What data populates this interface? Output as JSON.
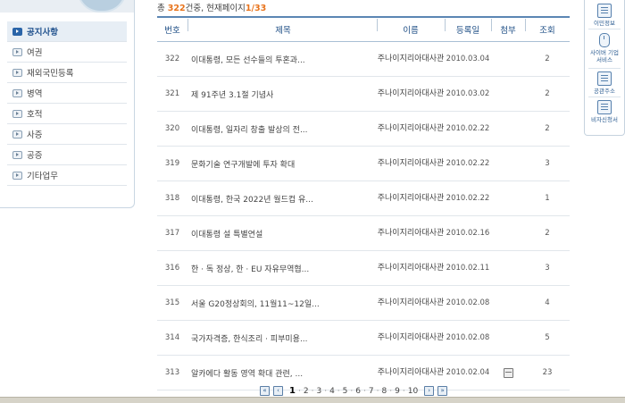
{
  "sidebar": {
    "items": [
      {
        "label": "공지사항",
        "active": true
      },
      {
        "label": "여권",
        "active": false
      },
      {
        "label": "재외국민등록",
        "active": false
      },
      {
        "label": "병역",
        "active": false
      },
      {
        "label": "호적",
        "active": false
      },
      {
        "label": "사증",
        "active": false
      },
      {
        "label": "공증",
        "active": false
      },
      {
        "label": "기타업무",
        "active": false
      }
    ]
  },
  "summary": {
    "prefix": "총 ",
    "total": "322",
    "middle": "건중, 현재페이지",
    "current": "1",
    "sep": "/",
    "pages": "33"
  },
  "table": {
    "headers": {
      "no": "번호",
      "title": "제목",
      "name": "이름",
      "date": "등록일",
      "attach": "첨부",
      "views": "조회"
    },
    "rows": [
      {
        "no": "322",
        "title": "이대통령, 모든 선수들의 투혼과...",
        "name": "주나이지리아대사관",
        "date": "2010.03.04",
        "attach": false,
        "views": "2"
      },
      {
        "no": "321",
        "title": "제 91주년 3.1절 기념사",
        "name": "주나이지리아대사관",
        "date": "2010.03.02",
        "attach": false,
        "views": "2"
      },
      {
        "no": "320",
        "title": "이대통령, 일자리 창출 발상의 전...",
        "name": "주나이지리아대사관",
        "date": "2010.02.22",
        "attach": false,
        "views": "2"
      },
      {
        "no": "319",
        "title": "문화기술 연구개발에 투자 확대",
        "name": "주나이지리아대사관",
        "date": "2010.02.22",
        "attach": false,
        "views": "3"
      },
      {
        "no": "318",
        "title": "이대통령, 한국 2022년 월드컵 유...",
        "name": "주나이지리아대사관",
        "date": "2010.02.22",
        "attach": false,
        "views": "1"
      },
      {
        "no": "317",
        "title": "이대통령 설 특별연설",
        "name": "주나이지리아대사관",
        "date": "2010.02.16",
        "attach": false,
        "views": "2"
      },
      {
        "no": "316",
        "title": "한 · 독 정상, 한 · EU 자유무역협...",
        "name": "주나이지리아대사관",
        "date": "2010.02.11",
        "attach": false,
        "views": "3"
      },
      {
        "no": "315",
        "title": "서울 G20정상회의, 11월11~12일...",
        "name": "주나이지리아대사관",
        "date": "2010.02.08",
        "attach": false,
        "views": "4"
      },
      {
        "no": "314",
        "title": "국가자격증, 한식조리 · 피부미용...",
        "name": "주나이지리아대사관",
        "date": "2010.02.08",
        "attach": false,
        "views": "5"
      },
      {
        "no": "313",
        "title": "알카에다 활동 영역 확대 관련, ...",
        "name": "주나이지리아대사관",
        "date": "2010.02.04",
        "attach": true,
        "views": "23"
      }
    ]
  },
  "pagination": {
    "current": "1",
    "pages": [
      "1",
      "2",
      "3",
      "4",
      "5",
      "6",
      "7",
      "8",
      "9",
      "10"
    ],
    "first_icon": "double-chevron-left-icon",
    "prev_icon": "chevron-left-icon",
    "next_icon": "chevron-right-icon",
    "last_icon": "double-chevron-right-icon"
  },
  "quick_panel": {
    "items": [
      {
        "label": "이민정보",
        "icon": "board-icon"
      },
      {
        "label": "사이버 기업서비스",
        "icon": "mouse-icon"
      },
      {
        "label": "공관주소",
        "icon": "board-icon"
      },
      {
        "label": "비자신청서",
        "icon": "document-icon"
      }
    ]
  },
  "colors": {
    "accent": "#e8731b",
    "header_text": "#1f4f86",
    "header_border": "#5b86b3"
  }
}
